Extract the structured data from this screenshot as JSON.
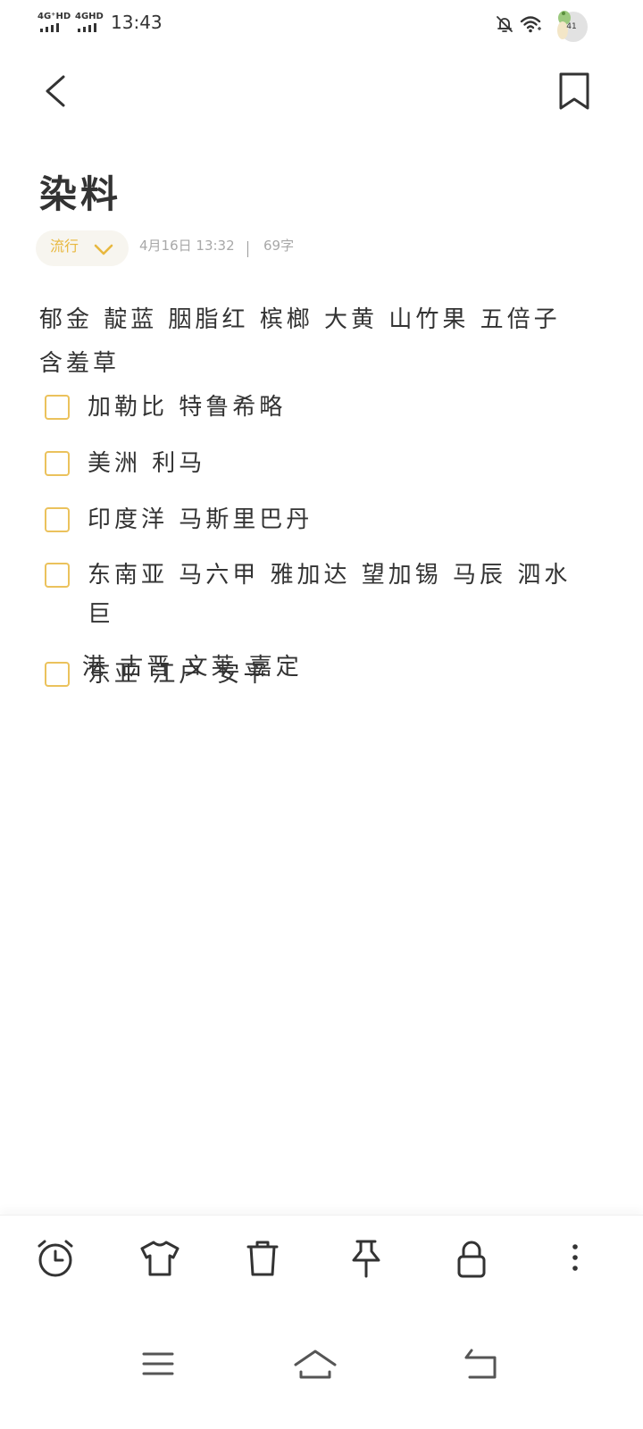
{
  "status_bar": {
    "sim1_label": "4G⁺HD",
    "sim2_label": "4GHD",
    "time": "13:43",
    "battery_level": "41",
    "icons": [
      "bell-off-icon",
      "wifi-icon",
      "battery-icon"
    ]
  },
  "header": {
    "back_icon": "back-icon",
    "bookmark_icon": "bookmark-icon"
  },
  "note": {
    "title": "染料",
    "category": "流行",
    "date": "4月16日 13:32",
    "word_count": "69字",
    "body_text": "郁金 靛蓝 胭脂红 槟榔 大黄 山竹果 五倍子 含羞草",
    "checklist": [
      {
        "text": "加勒比 特鲁希略",
        "checked": false
      },
      {
        "text": "美洲 利马",
        "checked": false
      },
      {
        "text": "印度洋 马斯里巴丹",
        "checked": false
      },
      {
        "text": "东南亚 马六甲 雅加达 望加锡 马辰 泗水 巨",
        "text_cont": "港 古晋 文莱 嘉定",
        "checked": false
      },
      {
        "text": "东亚 江户 安平",
        "checked": false
      }
    ]
  },
  "toolbar": {
    "items": [
      "alarm-icon",
      "tshirt-icon",
      "trash-icon",
      "pin-icon",
      "lock-icon",
      "more-icon"
    ]
  },
  "navigation": {
    "items": [
      "menu-icon",
      "home-icon",
      "return-icon"
    ]
  },
  "colors": {
    "accent": "#e8b83f",
    "checkbox_border": "#ebc25c",
    "text": "#333333",
    "meta_text": "#a8a8a8",
    "pill_background": "#f7f5ef"
  }
}
